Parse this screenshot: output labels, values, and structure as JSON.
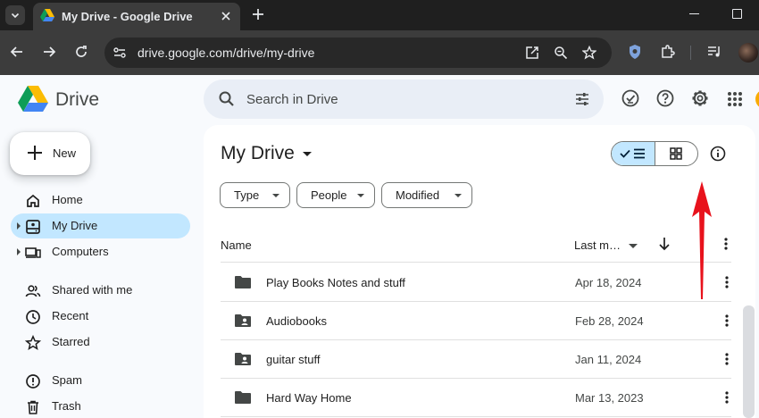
{
  "browser": {
    "tab_title": "My Drive - Google Drive",
    "url": "drive.google.com/drive/my-drive"
  },
  "app": {
    "name": "Drive",
    "search_placeholder": "Search in Drive",
    "new_label": "New"
  },
  "sidebar": {
    "items": [
      {
        "label": "Home",
        "icon": "home-icon"
      },
      {
        "label": "My Drive",
        "icon": "my-drive-icon",
        "selected": true
      },
      {
        "label": "Computers",
        "icon": "computers-icon"
      },
      {
        "label": "Shared with me",
        "icon": "shared-icon"
      },
      {
        "label": "Recent",
        "icon": "clock-icon"
      },
      {
        "label": "Starred",
        "icon": "star-icon"
      },
      {
        "label": "Spam",
        "icon": "spam-icon"
      },
      {
        "label": "Trash",
        "icon": "trash-icon"
      }
    ]
  },
  "main": {
    "title": "My Drive",
    "filters": [
      "Type",
      "People",
      "Modified"
    ],
    "columns": {
      "name": "Name",
      "modified": "Last m…"
    },
    "files": [
      {
        "name": "Play Books Notes and stuff",
        "modified": "Apr 18, 2024",
        "icon": "folder-icon"
      },
      {
        "name": "Audiobooks",
        "modified": "Feb 28, 2024",
        "icon": "shared-folder-icon"
      },
      {
        "name": "guitar stuff",
        "modified": "Jan 11, 2024",
        "icon": "shared-folder-icon"
      },
      {
        "name": "Hard Way Home",
        "modified": "Mar 13, 2023",
        "icon": "folder-icon"
      }
    ]
  },
  "colors": {
    "selected_nav": "#c2e7ff",
    "search_bg": "#e9eef6",
    "annotation_arrow": "#e8121c"
  }
}
